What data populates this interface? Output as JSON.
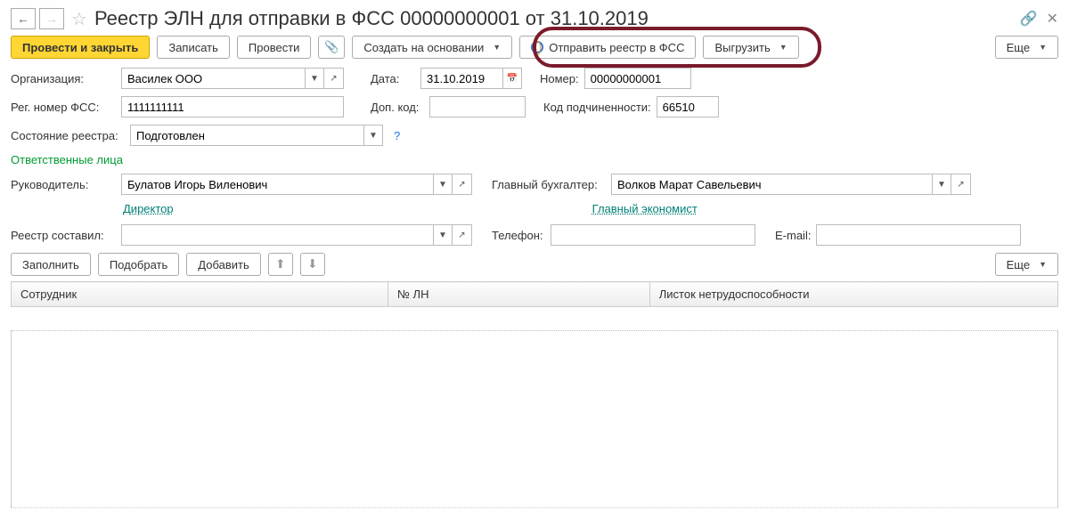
{
  "title": "Реестр ЭЛН для отправки в ФСС 00000000001 от 31.10.2019",
  "toolbar": {
    "post_close": "Провести и закрыть",
    "save": "Записать",
    "post": "Провести",
    "create_based": "Создать на основании",
    "send_fss": "Отправить реестр в ФСС",
    "export": "Выгрузить",
    "more": "Еще"
  },
  "row1": {
    "org_label": "Организация:",
    "org_value": "Василек ООО",
    "date_label": "Дата:",
    "date_value": "31.10.2019",
    "num_label": "Номер:",
    "num_value": "00000000001"
  },
  "row2": {
    "reg_label": "Рег. номер ФСС:",
    "reg_value": "1111111111",
    "dop_label": "Доп. код:",
    "dop_value": "",
    "sub_label": "Код подчиненности:",
    "sub_value": "66510"
  },
  "row3": {
    "state_label": "Состояние реестра:",
    "state_value": "Подготовлен"
  },
  "section_resp": "Ответственные лица",
  "resp": {
    "head_label": "Руководитель:",
    "head_value": "Булатов Игорь Виленович",
    "head_link": "Директор",
    "acc_label": "Главный бухгалтер:",
    "acc_value": "Волков Марат Савельевич",
    "acc_link": "Главный экономист",
    "made_label": "Реестр составил:",
    "made_value": "",
    "phone_label": "Телефон:",
    "phone_value": "",
    "email_label": "E-mail:",
    "email_value": ""
  },
  "table_toolbar": {
    "fill": "Заполнить",
    "pick": "Подобрать",
    "add": "Добавить",
    "more": "Еще"
  },
  "columns": {
    "emp": "Сотрудник",
    "ln": "№ ЛН",
    "sheet": "Листок нетрудоспособности"
  }
}
